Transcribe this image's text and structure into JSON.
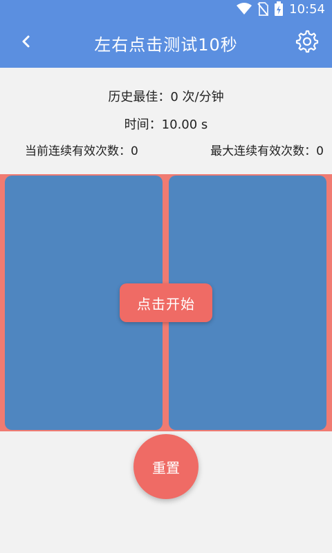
{
  "status_bar": {
    "time": "10:54",
    "icons": [
      "wifi-icon",
      "no-sim-icon",
      "battery-charging-icon"
    ]
  },
  "app_bar": {
    "title": "左右点击测试10秒",
    "back_icon": "chevron-left-icon",
    "settings_icon": "gear-icon"
  },
  "stats": {
    "best": "历史最佳：0 次/分钟",
    "time": "时间：10.00 s",
    "current_streak": "当前连续有效次数：0",
    "max_streak": "最大连续有效次数：0"
  },
  "buttons": {
    "start": "点击开始",
    "reset": "重置"
  },
  "colors": {
    "primary": "#5b8fe0",
    "pad": "#4f86c0",
    "accent": "#ef6b65",
    "arena_bg": "#f07b72"
  }
}
